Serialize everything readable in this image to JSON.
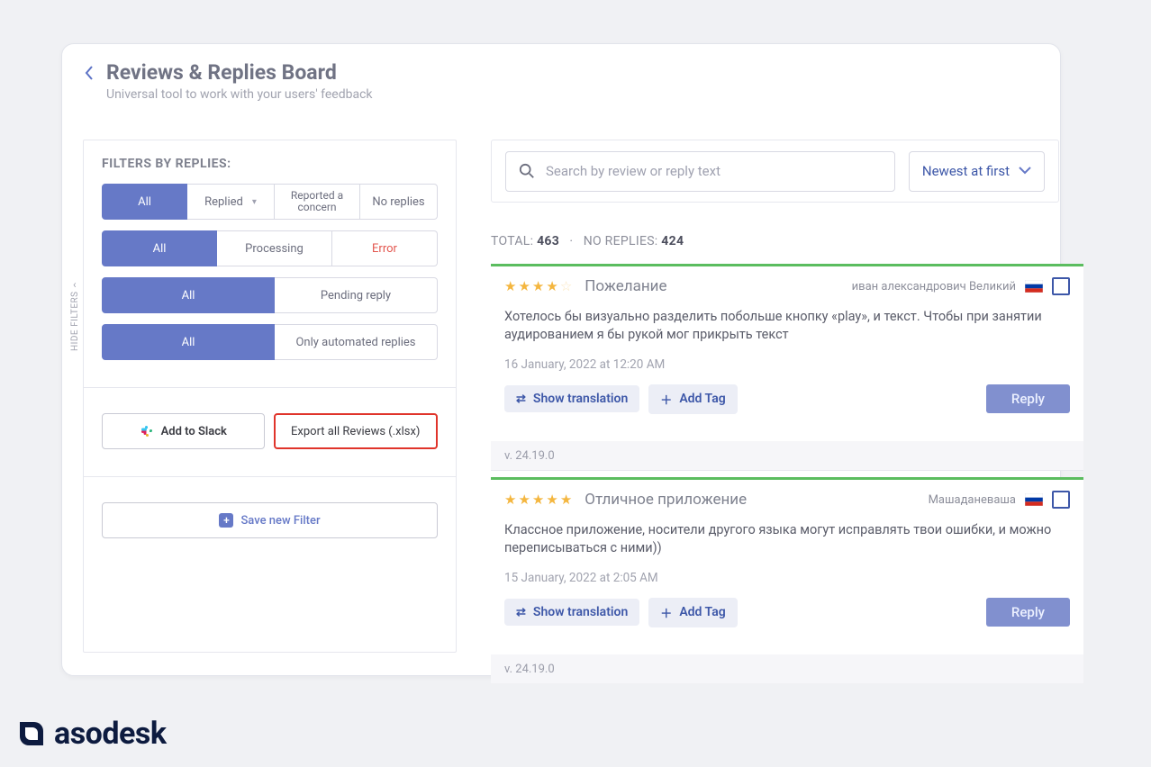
{
  "header": {
    "title": "Reviews & Replies Board",
    "subtitle": "Universal tool to work with your users' feedback"
  },
  "hide_filters": "HIDE FILTERS",
  "filters": {
    "heading": "FILTERS BY REPLIES:",
    "row1": {
      "all": "All",
      "replied": "Replied",
      "reported": "Reported a concern",
      "none": "No replies"
    },
    "row2": {
      "all": "All",
      "processing": "Processing",
      "error": "Error"
    },
    "row3": {
      "all": "All",
      "pending": "Pending reply"
    },
    "row4": {
      "all": "All",
      "auto": "Only automated replies"
    },
    "slack": "Add to Slack",
    "export": "Export all Reviews (.xlsx)",
    "save": "Save new Filter"
  },
  "toolbar": {
    "search_placeholder": "Search by review or reply text",
    "sort": "Newest at first"
  },
  "totals": {
    "total_label": "TOTAL: ",
    "total": "463",
    "sep": " · ",
    "noreply_label": "NO REPLIES: ",
    "noreply": "424"
  },
  "actions": {
    "translate": "Show translation",
    "addtag": "Add Tag",
    "reply": "Reply"
  },
  "reviews": [
    {
      "rating": 4,
      "title": "Пожелание",
      "author": "иван александрович Великий",
      "body": "Хотелось бы визуально разделить побольше кнопку «play», и текст. Чтобы при занятии аудированием я бы рукой мог прикрыть текст",
      "date": "16 January, 2022 at 12:20 AM",
      "version": "v. 24.19.0"
    },
    {
      "rating": 5,
      "title": "Отличное приложение",
      "author": "Машаданеваша",
      "body": "Классное приложение, носители другого языка могут исправлять твои ошибки, и можно переписываться с ними))",
      "date": "15 January, 2022 at 2:05 AM",
      "version": "v. 24.19.0"
    }
  ],
  "brand": "asodesk"
}
